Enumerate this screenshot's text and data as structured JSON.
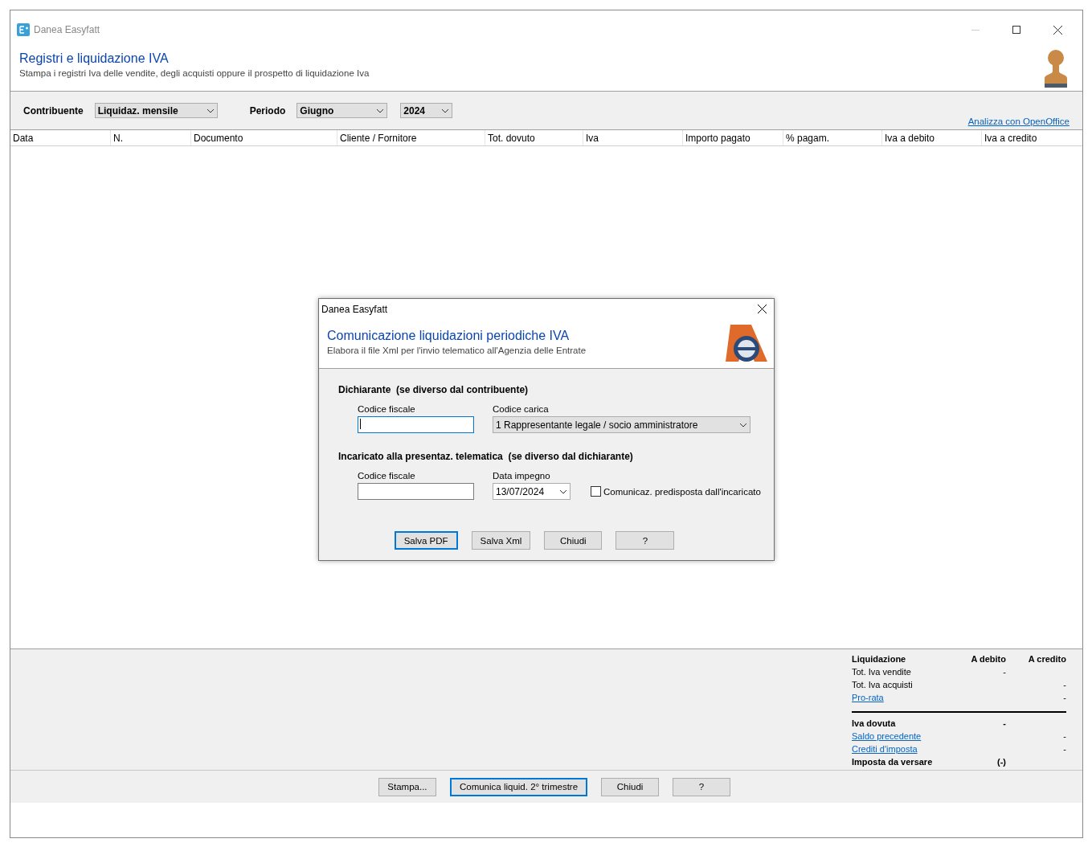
{
  "window": {
    "title": "Danea Easyfatt"
  },
  "header": {
    "title": "Registri e liquidazione IVA",
    "subtitle": "Stampa i registri Iva delle vendite, degli acquisti oppure il prospetto di liquidazione Iva"
  },
  "toolbar": {
    "filters": [
      {
        "label": "Contribuente",
        "value": "Liquidaz. mensile"
      },
      {
        "label": "Periodo",
        "value": "Giugno"
      },
      {
        "value": "2024"
      }
    ],
    "link": "Analizza con OpenOffice"
  },
  "table": {
    "columns": [
      "Data",
      "N.",
      "Documento",
      "Cliente / Fornitore",
      "Tot. dovuto",
      "Iva",
      "Importo pagato",
      "% pagam.",
      "Iva a debito",
      "Iva a credito"
    ]
  },
  "summary": {
    "columns": [
      "Liquidazione",
      "A debito",
      "A credito"
    ],
    "rows": [
      {
        "kind": "plain",
        "label": "Tot. Iva vendite",
        "debit": "-"
      },
      {
        "kind": "plain",
        "label": "Tot. Iva acquisti",
        "credit": "-"
      },
      {
        "kind": "link",
        "label": "Pro-rata",
        "credit": "-"
      },
      {
        "kind": "rule"
      },
      {
        "kind": "bold",
        "label": "Iva dovuta",
        "debit": "-"
      },
      {
        "kind": "link",
        "label": "Saldo precedente",
        "credit": "-"
      },
      {
        "kind": "link",
        "label": "Crediti d'imposta",
        "credit": "-"
      },
      {
        "kind": "bold",
        "label": "Imposta da versare",
        "debit": "(-)"
      }
    ]
  },
  "footer": {
    "buttons": [
      {
        "label": "Stampa...",
        "default": false
      },
      {
        "label": "Comunica liquid. 2° trimestre",
        "default": true
      },
      {
        "label": "Chiudi",
        "default": false
      },
      {
        "label": "?",
        "default": false
      }
    ]
  },
  "dialog": {
    "title": "Danea Easyfatt",
    "heading": "Comunicazione liquidazioni periodiche IVA",
    "subtitle": "Elabora il file Xml per l'invio telematico all'Agenzia delle Entrate",
    "sections": [
      {
        "title": "Dichiarante",
        "note": "(se diverso dal contribuente)",
        "fields": [
          {
            "kind": "text",
            "label": "Codice fiscale",
            "focused": true
          },
          {
            "kind": "select",
            "label": "Codice carica",
            "value": "1  Rappresentante legale / socio amministratore"
          }
        ]
      },
      {
        "title": "Incaricato alla presentaz. telematica",
        "note": "(se diverso dal dichiarante)",
        "fields": [
          {
            "kind": "text",
            "label": "Codice fiscale",
            "focused": false
          },
          {
            "kind": "select",
            "label": "Data impegno",
            "value": "13/07/2024"
          },
          {
            "kind": "checkbox",
            "label": "Comunicaz. predisposta dall'incaricato",
            "checked": false
          }
        ]
      }
    ],
    "buttons": [
      {
        "label": "Salva PDF",
        "default": true
      },
      {
        "label": "Salva Xml",
        "default": false
      },
      {
        "label": "Chiudi",
        "default": false
      },
      {
        "label": "?",
        "default": false
      }
    ]
  }
}
